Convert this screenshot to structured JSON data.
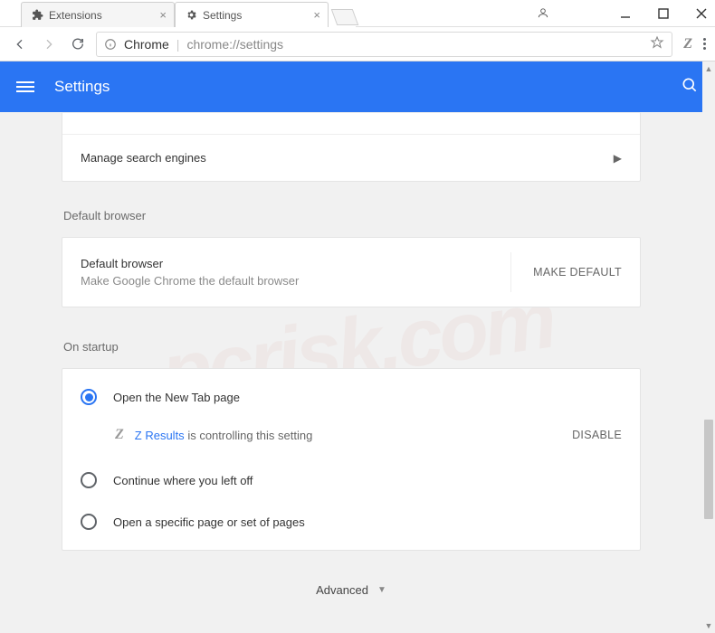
{
  "window": {
    "tabs": [
      {
        "label": "Extensions",
        "icon": "puzzle-piece"
      },
      {
        "label": "Settings",
        "icon": "gear"
      }
    ],
    "active_tab": 1
  },
  "addressbar": {
    "scheme_label": "Chrome",
    "url": "chrome://settings"
  },
  "header": {
    "title": "Settings"
  },
  "search_engines_row": {
    "label": "Manage search engines"
  },
  "default_browser": {
    "section_label": "Default browser",
    "title": "Default browser",
    "sub": "Make Google Chrome the default browser",
    "button": "MAKE DEFAULT"
  },
  "startup": {
    "section_label": "On startup",
    "options": [
      {
        "label": "Open the New Tab page",
        "checked": true
      },
      {
        "label": "Continue where you left off",
        "checked": false
      },
      {
        "label": "Open a specific page or set of pages",
        "checked": false
      }
    ],
    "extension": {
      "name": "Z Results",
      "message": "is controlling this setting",
      "action": "DISABLE"
    }
  },
  "advanced_label": "Advanced"
}
